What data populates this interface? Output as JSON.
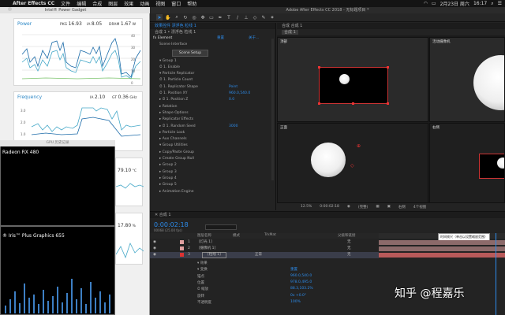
{
  "menubar": {
    "app_name": "After Effects CC",
    "items": [
      "文件",
      "编辑",
      "合成",
      "图层",
      "效果",
      "动画",
      "视图",
      "窗口",
      "帮助"
    ],
    "date": "2月23日 周六",
    "time": "16:17"
  },
  "gadget": {
    "title": "Intel® Power Gadget",
    "power": {
      "label": "Power",
      "pkg_label": "PKG",
      "pkg_value": "16.93",
      "ia_label": "IA",
      "ia_value": "8.05",
      "dram_label": "DRAM",
      "dram_value": "1.67",
      "unit": "W",
      "yticks": [
        "40",
        "30",
        "20",
        "10",
        "0"
      ]
    },
    "frequency": {
      "label": "Frequency",
      "ia_label": "IA",
      "ia_value": "2.10",
      "gt_label": "GT",
      "gt_value": "0.36",
      "unit": "GHz",
      "yticks": [
        "3.0",
        "2.0",
        "1.0"
      ]
    },
    "temp": {
      "value": "79.10",
      "unit": "°C"
    },
    "util": {
      "value": "17.80",
      "unit": "%"
    }
  },
  "gpu_window": {
    "title": "GPU 历史记录",
    "gpu1": "Radeon RX 480",
    "gpu2": "® Iris™ Plus Graphics 655"
  },
  "ae": {
    "window_title": "Adobe After Effects CC 2018 - 无标题项目 *",
    "effects_tab": "效果控件 漂浮色 粒线 1",
    "comp_path": "合成 1 • 漂浮色 粒线 1",
    "effect_name": "Element",
    "reset": "重置",
    "about": "关于...",
    "scene_interface": "Scene Interface",
    "scene_setup": "Scene Setup",
    "rows": [
      {
        "label": "▾ Group 1",
        "val": ""
      },
      {
        "label": "    ⏱ 1. Enable",
        "val": ""
      },
      {
        "label": "  ▾ Particle Replicator",
        "val": ""
      },
      {
        "label": "      ⏱ 1. Particle Count",
        "val": ""
      },
      {
        "label": "      ⏱ 1. Replicator Shape",
        "val": "Point"
      },
      {
        "label": "      ⏱ 1. Position XY",
        "val": "960.0,540.0"
      },
      {
        "label": "    ▸ ⏱ 1. Position Z",
        "val": "0.0"
      },
      {
        "label": "    ▸ Rotation",
        "val": ""
      },
      {
        "label": "    ▸ Shape Options",
        "val": ""
      },
      {
        "label": "    ▸ Replicator Effects",
        "val": ""
      },
      {
        "label": "    ▸ ⏱ 1. Random Seed",
        "val": "3000"
      },
      {
        "label": "  ▸ Particle Look",
        "val": ""
      },
      {
        "label": "  ▸ Aux Channels",
        "val": ""
      },
      {
        "label": "  ▾ Group Utilities",
        "val": ""
      },
      {
        "label": "      ▸ Copy/Paste Group",
        "val": ""
      },
      {
        "label": "      ▸ Create Group Null",
        "val": ""
      },
      {
        "label": "▸ Group 2",
        "val": ""
      },
      {
        "label": "▸ Group 3",
        "val": ""
      },
      {
        "label": "▸ Group 4",
        "val": ""
      },
      {
        "label": "▸ Group 5",
        "val": ""
      },
      {
        "label": "▸ Animation Engine",
        "val": ""
      }
    ],
    "comp_tab": "合成 合成 1",
    "comp_sub": "合成 1",
    "views": {
      "top": "顶部",
      "active": "活动摄像机",
      "front": "正面",
      "right": "右侧"
    },
    "viewer_bar": {
      "zoom": "12.5%",
      "timecode": "0:00:02:18",
      "resolution": "(完整)",
      "camera": "右侧",
      "views": "4个视图"
    },
    "timeline": {
      "tab": "合成 1",
      "time": "0:00:02:18",
      "frame_info": "00068 (25.00 fps)",
      "col_source": "图层名称",
      "col_mode": "模式",
      "col_trk": "TrkMat",
      "col_parent": "父级和链接",
      "tooltip": "时间帧尺（单击以设置缩放范围）",
      "layers": [
        {
          "num": "1",
          "name": "[灯光 1]",
          "parent": "无"
        },
        {
          "num": "2",
          "name": "[摄像机 1]",
          "parent": "无"
        },
        {
          "num": "3",
          "name": "[粒线 1]",
          "mode": "正常",
          "parent": "无"
        }
      ],
      "props": [
        {
          "label": "▾ 效果",
          "val": ""
        },
        {
          "label": "▾ 变换",
          "val": "重置"
        },
        {
          "label": "    锚点",
          "val": "960.0,540.0"
        },
        {
          "label": "    位置",
          "val": "978.0,495.0"
        },
        {
          "label": "    ⏱ 缩放",
          "val": "88.3,103.2%"
        },
        {
          "label": "    旋转",
          "val": "0x +0.0°"
        },
        {
          "label": "    不透明度",
          "val": "100%"
        }
      ]
    }
  },
  "watermark": "知乎 @程嘉乐",
  "colors": {
    "accent": "#2d8ceb",
    "selected_layer": "#3a3d4a",
    "red_handle": "#e33333"
  }
}
